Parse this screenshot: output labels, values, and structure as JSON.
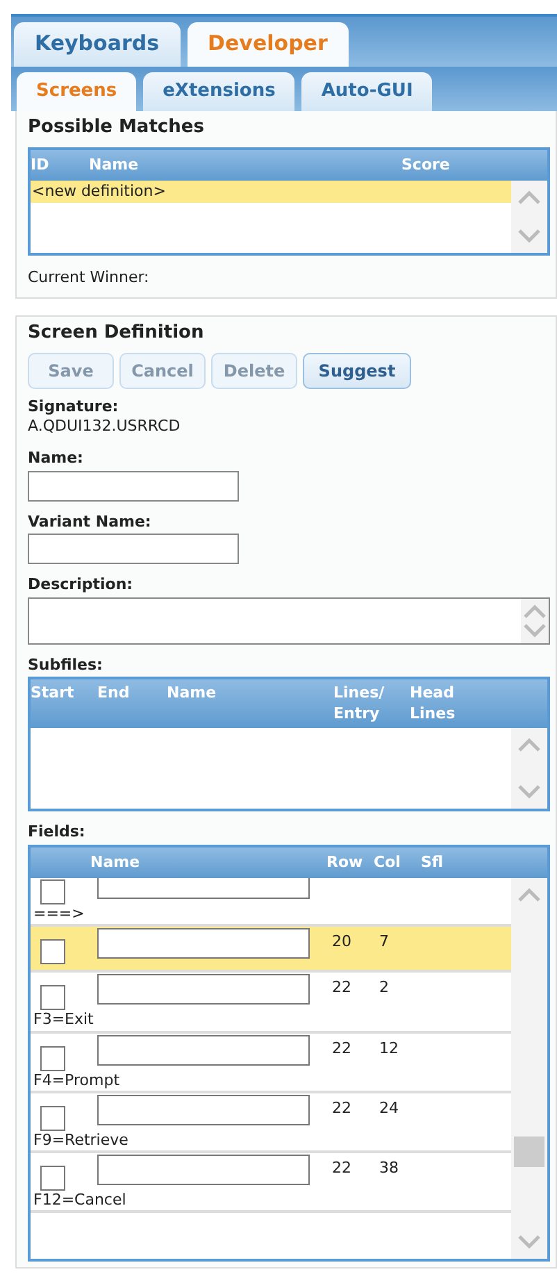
{
  "top_tabs": [
    {
      "label": "Keyboards",
      "selected": false
    },
    {
      "label": "Developer",
      "selected": true
    }
  ],
  "sub_tabs": [
    {
      "label": "Screens",
      "selected": true
    },
    {
      "label": "eXtensions",
      "selected": false
    },
    {
      "label": "Auto-GUI",
      "selected": false
    }
  ],
  "possible_matches": {
    "title": "Possible Matches",
    "columns": [
      "ID",
      "Name",
      "Score"
    ],
    "rows": [
      {
        "name": "<new definition>",
        "selected": true
      }
    ],
    "current_winner_label": "Current Winner:"
  },
  "screen_definition": {
    "title": "Screen Definition",
    "buttons": [
      {
        "label": "Save",
        "disabled": true
      },
      {
        "label": "Cancel",
        "disabled": true
      },
      {
        "label": "Delete",
        "disabled": true
      },
      {
        "label": "Suggest",
        "disabled": false
      }
    ],
    "signature_label": "Signature:",
    "signature": "A.QDUI132.USRRCD",
    "name_label": "Name:",
    "variant_label": "Variant Name:",
    "description_label": "Description:",
    "subfiles_label": "Subfiles:",
    "subfiles_columns": [
      "Start",
      "End",
      "Name",
      "Lines/ Entry",
      "Head Lines"
    ],
    "fields_label": "Fields:",
    "fields_columns": [
      "Name",
      "Row",
      "Col",
      "Sfl"
    ],
    "fields": [
      {
        "label": "===>",
        "selected": false,
        "checked": false
      },
      {
        "row": "20",
        "col": "7",
        "selected": true,
        "checked": false
      },
      {
        "row": "22",
        "col": "2",
        "label": "F3=Exit",
        "selected": false,
        "checked": false
      },
      {
        "row": "22",
        "col": "12",
        "label": "F4=Prompt",
        "selected": false,
        "checked": false
      },
      {
        "row": "22",
        "col": "24",
        "label": "F9=Retrieve",
        "selected": false,
        "checked": false
      },
      {
        "row": "22",
        "col": "38",
        "label": "F12=Cancel",
        "selected": false,
        "checked": false
      }
    ]
  }
}
